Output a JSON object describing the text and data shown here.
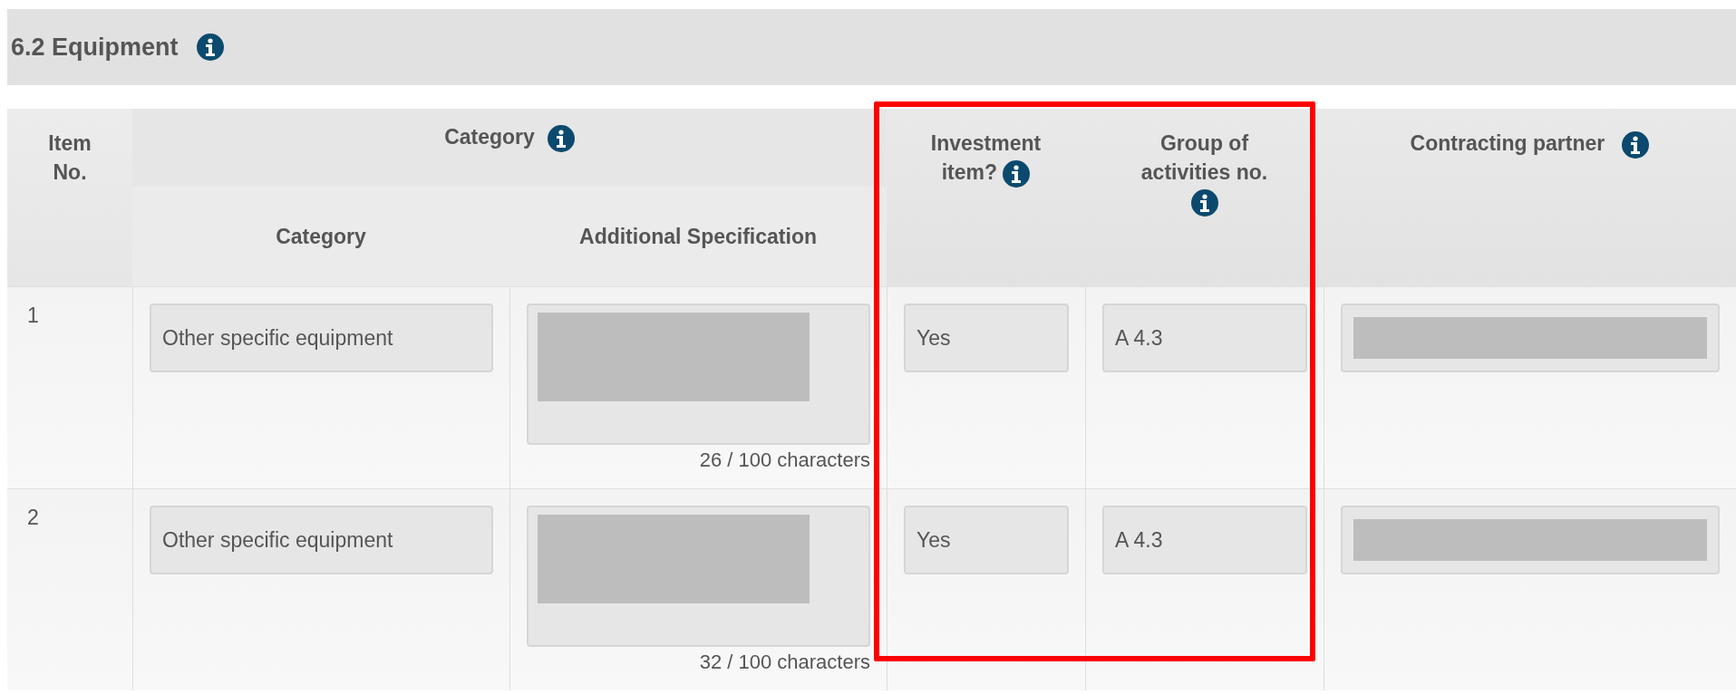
{
  "section": {
    "title": "6.2 Equipment"
  },
  "table": {
    "header": {
      "item_no": "Item No.",
      "category_group": "Category",
      "sub_columns": [
        "Category",
        "Additional Specification"
      ],
      "investment_item": "Investment item?",
      "group_of_activities": "Group of activities no.",
      "contracting_partner": "Contracting partner"
    },
    "rows": [
      {
        "item_no": "1",
        "category": "Other specific equipment",
        "specification_counter": "26 / 100 characters",
        "investment_item": "Yes",
        "group_of_activities": "A 4.3"
      },
      {
        "item_no": "2",
        "category": "Other specific equipment",
        "specification_counter": "32 / 100 characters",
        "investment_item": "Yes",
        "group_of_activities": "A 4.3"
      }
    ]
  }
}
